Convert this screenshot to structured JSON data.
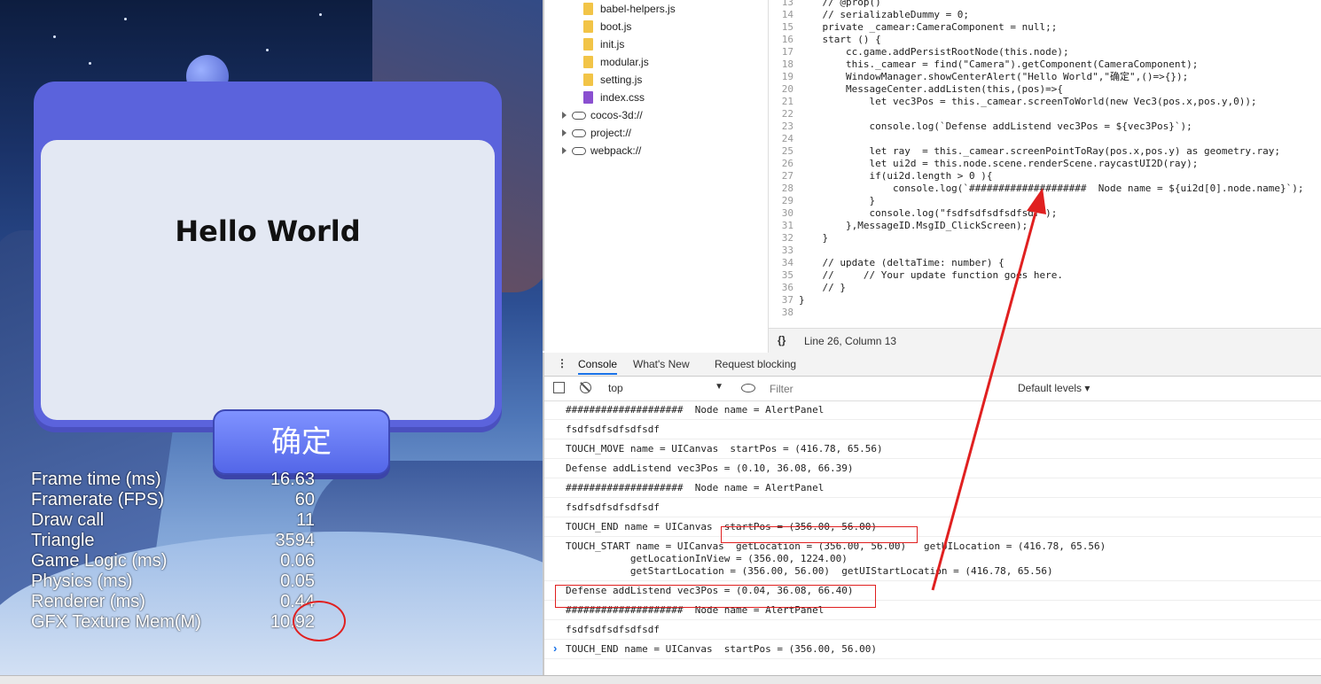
{
  "game": {
    "alert": {
      "title": "Hello World",
      "ok_label": "确定"
    },
    "stats": [
      {
        "label": "Frame time (ms)",
        "value": "16.63"
      },
      {
        "label": "Framerate (FPS)",
        "value": "60"
      },
      {
        "label": "Draw call",
        "value": "11"
      },
      {
        "label": "Triangle",
        "value": "3594"
      },
      {
        "label": "Game Logic (ms)",
        "value": "0.06"
      },
      {
        "label": "Physics (ms)",
        "value": "0.05"
      },
      {
        "label": "Renderer (ms)",
        "value": "0.44"
      },
      {
        "label": "GFX Texture Mem(M)",
        "value": "10.92"
      }
    ]
  },
  "filetree": {
    "files": [
      {
        "name": "babel-helpers.js",
        "icon": "js-file-icon"
      },
      {
        "name": "boot.js",
        "icon": "js-file-icon"
      },
      {
        "name": "init.js",
        "icon": "js-file-icon"
      },
      {
        "name": "modular.js",
        "icon": "js-file-icon"
      },
      {
        "name": "setting.js",
        "icon": "js-file-icon"
      },
      {
        "name": "index.css",
        "icon": "css-file-icon"
      }
    ],
    "origins": [
      "cocos-3d://",
      "project://",
      "webpack://"
    ]
  },
  "editor": {
    "lines": [
      {
        "n": "13",
        "t": "    // @prop()"
      },
      {
        "n": "14",
        "t": "    // serializableDummy = 0;"
      },
      {
        "n": "15",
        "t": "    private _camear:CameraComponent = null;;"
      },
      {
        "n": "16",
        "t": "    start () {"
      },
      {
        "n": "17",
        "t": "        cc.game.addPersistRootNode(this.node);"
      },
      {
        "n": "18",
        "t": "        this._camear = find(\"Camera\").getComponent(CameraComponent);"
      },
      {
        "n": "19",
        "t": "        WindowManager.showCenterAlert(\"Hello World\",\"确定\",()=>{});"
      },
      {
        "n": "20",
        "t": "        MessageCenter.addListen(this,(pos)=>{"
      },
      {
        "n": "21",
        "t": "            let vec3Pos = this._camear.screenToWorld(new Vec3(pos.x,pos.y,0));"
      },
      {
        "n": "22",
        "t": ""
      },
      {
        "n": "23",
        "t": "            console.log(`Defense addListend vec3Pos = ${vec3Pos}`);"
      },
      {
        "n": "24",
        "t": ""
      },
      {
        "n": "25",
        "t": "            let ray  = this._camear.screenPointToRay(pos.x,pos.y) as geometry.ray;"
      },
      {
        "n": "26",
        "t": "            let ui2d = this.node.scene.renderScene.raycastUI2D(ray);"
      },
      {
        "n": "27",
        "t": "            if(ui2d.length > 0 ){"
      },
      {
        "n": "28",
        "t": "                console.log(`####################  Node name = ${ui2d[0].node.name}`);"
      },
      {
        "n": "29",
        "t": "            }"
      },
      {
        "n": "30",
        "t": "            console.log(\"fsdfsdfsdfsdfsdf\");"
      },
      {
        "n": "31",
        "t": "        },MessageID.MsgID_ClickScreen);"
      },
      {
        "n": "32",
        "t": "    }"
      },
      {
        "n": "33",
        "t": ""
      },
      {
        "n": "34",
        "t": "    // update (deltaTime: number) {"
      },
      {
        "n": "35",
        "t": "    //     // Your update function goes here."
      },
      {
        "n": "36",
        "t": "    // }"
      },
      {
        "n": "37",
        "t": "}"
      },
      {
        "n": "38",
        "t": ""
      }
    ],
    "status": "Line 26, Column 13"
  },
  "console": {
    "tabs": [
      "Console",
      "What's New",
      "Request blocking"
    ],
    "context": "top",
    "filter_placeholder": "Filter",
    "levels": "Default levels ▾",
    "messages": [
      "####################  Node name = AlertPanel",
      "fsdfsdfsdfsdfsdf",
      "TOUCH_MOVE name = UICanvas  startPos = (416.78, 65.56)",
      "Defense addListend vec3Pos = (0.10, 36.08, 66.39)",
      "####################  Node name = AlertPanel",
      "fsdfsdfsdfsdfsdf",
      "TOUCH_END name = UICanvas  startPos = (356.00, 56.00)",
      "TOUCH_START name = UICanvas  getLocation = (356.00, 56.00)   getUILocation = (416.78, 65.56)\n           getLocationInView = (356.00, 1224.00)\n           getStartLocation = (356.00, 56.00)  getUIStartLocation = (416.78, 65.56)",
      "Defense addListend vec3Pos = (0.04, 36.08, 66.40)",
      "####################  Node name = AlertPanel",
      "fsdfsdfsdfsdfsdf",
      "TOUCH_END name = UICanvas  startPos = (356.00, 56.00)"
    ]
  },
  "colors": {
    "alert_purple": "#5b63dc",
    "annotation_red": "#e02020",
    "accent_blue": "#1a73e8"
  }
}
